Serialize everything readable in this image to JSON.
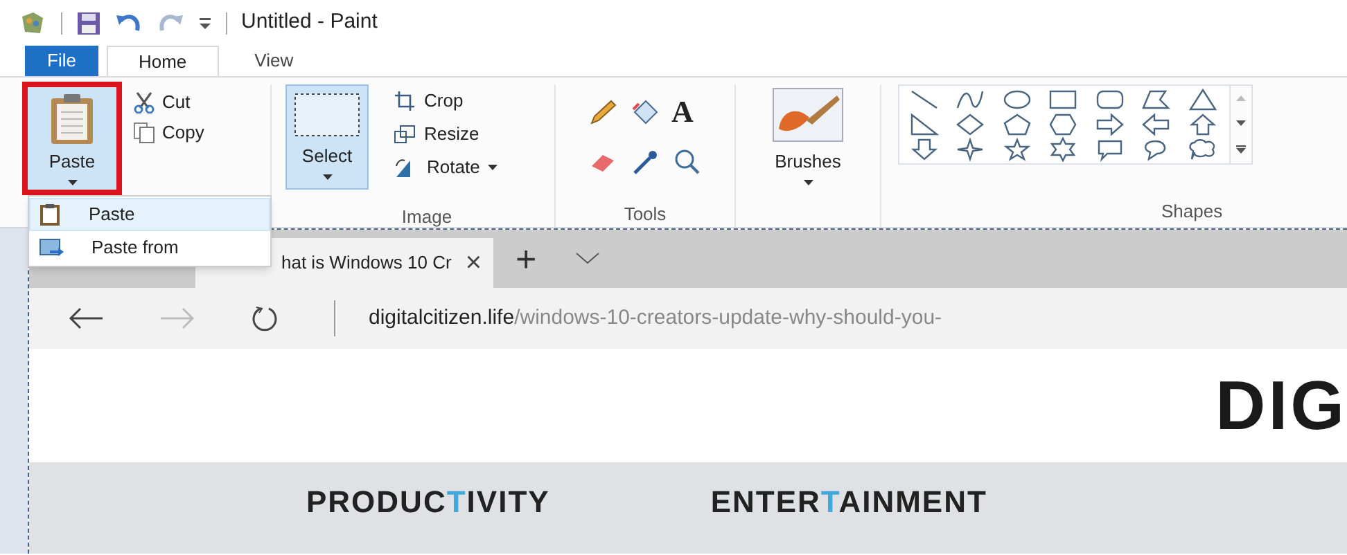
{
  "window": {
    "title": "Untitled - Paint"
  },
  "ribbon_tabs": [
    {
      "label": "File",
      "kind": "file",
      "selected": false
    },
    {
      "label": "Home",
      "kind": "tab",
      "selected": true
    },
    {
      "label": "View",
      "kind": "tab",
      "selected": false
    }
  ],
  "clipboard": {
    "paste": "Paste",
    "paste_highlighted": true,
    "cut": "Cut",
    "copy": "Copy"
  },
  "image": {
    "select": "Select",
    "crop": "Crop",
    "resize": "Resize",
    "rotate": "Rotate",
    "label": "Image"
  },
  "tools": {
    "label": "Tools",
    "text_tool": "A"
  },
  "brushes": {
    "label": "Brushes"
  },
  "shapes": {
    "label": "Shapes"
  },
  "paste_menu": [
    {
      "label": "Paste",
      "selected": true
    },
    {
      "label": "Paste from",
      "selected": false
    }
  ],
  "browser": {
    "tab_title": "hat is Windows 10 Cr",
    "tab_close": "×",
    "new_tab": "+",
    "address_domain": "digitalcitizen.life",
    "address_path": "/windows-10-creators-update-why-should-you-",
    "logo": "DIG",
    "nav": [
      {
        "before": "PRODUC",
        "accent": "T",
        "after": "IVITY"
      },
      {
        "before": "ENTER",
        "accent": "T",
        "after": "AINMENT"
      }
    ]
  }
}
